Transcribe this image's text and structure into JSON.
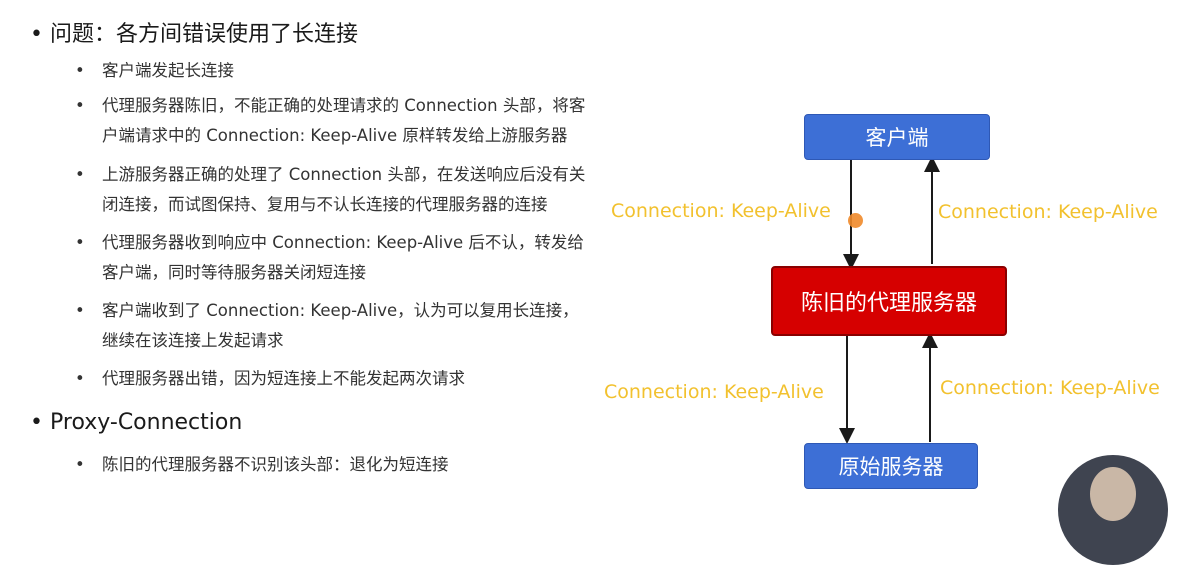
{
  "problem": {
    "title": "问题：各方间错误使用了长连接",
    "items": [
      {
        "lines": [
          "客户端发起长连接"
        ]
      },
      {
        "lines": [
          "代理服务器陈旧，不能正确的处理请求的 Connection 头部，将客",
          "户端请求中的 Connection: Keep-Alive 原样转发给上游服务器"
        ]
      },
      {
        "lines": [
          "上游服务器正确的处理了 Connection 头部，在发送响应后没有关",
          "闭连接，而试图保持、复用与不认长连接的代理服务器的连接"
        ]
      },
      {
        "lines": [
          "代理服务器收到响应中 Connection: Keep-Alive 后不认，转发给",
          "客户端，同时等待服务器关闭短连接"
        ]
      },
      {
        "lines": [
          "客户端收到了 Connection: Keep-Alive，认为可以复用长连接，",
          "继续在该连接上发起请求"
        ]
      },
      {
        "lines": [
          "代理服务器出错，因为短连接上不能发起两次请求"
        ]
      }
    ]
  },
  "proxy_connection": {
    "title": "Proxy-Connection",
    "items": [
      {
        "lines": [
          "陈旧的代理服务器不识别该头部：退化为短连接"
        ]
      }
    ]
  },
  "diagram": {
    "client": "客户端",
    "proxy": "陈旧的代理服务器",
    "origin": "原始服务器",
    "label_top_left": "Connection: Keep-Alive",
    "label_top_right": "Connection: Keep-Alive",
    "label_bottom_left": "Connection: Keep-Alive",
    "label_bottom_right": "Connection: Keep-Alive",
    "colors": {
      "client_box": "#3d6fd6",
      "proxy_box": "#d60000",
      "label": "#f2c12e"
    }
  },
  "bullet_glyph": "•"
}
